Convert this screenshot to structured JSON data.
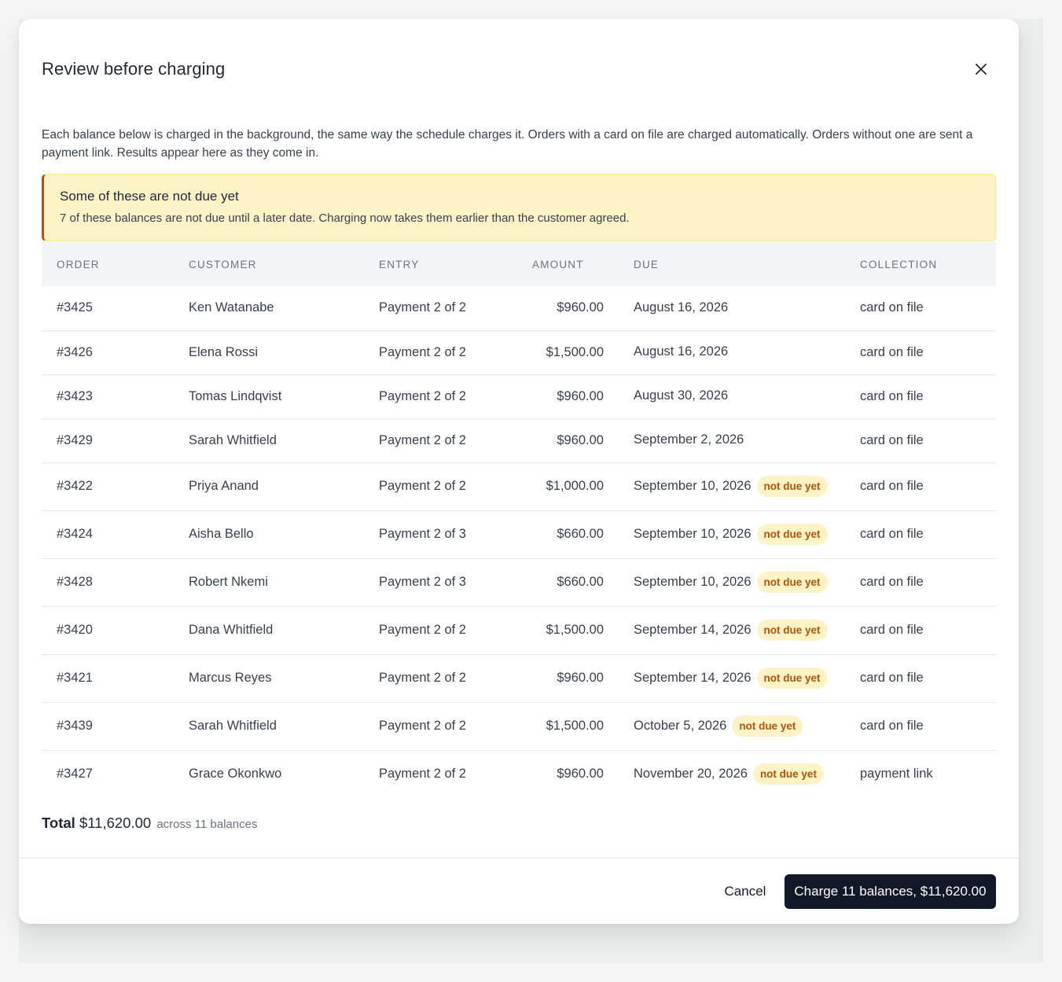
{
  "dialog": {
    "title": "Review before charging",
    "close_icon": "close-icon",
    "description": "Each balance below is charged in the background, the same way the schedule charges it. Orders with a card on file are charged automatically. Orders without one are sent a payment link. Results appear here as they come in."
  },
  "warning": {
    "title": "Some of these are not due yet",
    "text": "7 of these balances are not due until a later date. Charging now takes them earlier than the customer agreed.",
    "accent_color": "#b45309"
  },
  "table": {
    "headers": {
      "order": "ORDER",
      "customer": "CUSTOMER",
      "entry": "ENTRY",
      "amount": "AMOUNT",
      "due": "DUE",
      "collection": "COLLECTION"
    },
    "rows": [
      {
        "order": "#3425",
        "customer": "Ken Watanabe",
        "entry": "Payment 2 of 2",
        "amount": "$960.00",
        "due": "August 16, 2026",
        "badge": "",
        "collection": "card on file"
      },
      {
        "order": "#3426",
        "customer": "Elena Rossi",
        "entry": "Payment 2 of 2",
        "amount": "$1,500.00",
        "due": "August 16, 2026",
        "badge": "",
        "collection": "card on file"
      },
      {
        "order": "#3423",
        "customer": "Tomas Lindqvist",
        "entry": "Payment 2 of 2",
        "amount": "$960.00",
        "due": "August 30, 2026",
        "badge": "",
        "collection": "card on file"
      },
      {
        "order": "#3429",
        "customer": "Sarah Whitfield",
        "entry": "Payment 2 of 2",
        "amount": "$960.00",
        "due": "September 2, 2026",
        "badge": "",
        "collection": "card on file"
      },
      {
        "order": "#3422",
        "customer": "Priya Anand",
        "entry": "Payment 2 of 2",
        "amount": "$1,000.00",
        "due": "September 10, 2026",
        "badge": "not due yet",
        "collection": "card on file"
      },
      {
        "order": "#3424",
        "customer": "Aisha Bello",
        "entry": "Payment 2 of 3",
        "amount": "$660.00",
        "due": "September 10, 2026",
        "badge": "not due yet",
        "collection": "card on file"
      },
      {
        "order": "#3428",
        "customer": "Robert Nkemi",
        "entry": "Payment 2 of 3",
        "amount": "$660.00",
        "due": "September 10, 2026",
        "badge": "not due yet",
        "collection": "card on file"
      },
      {
        "order": "#3420",
        "customer": "Dana Whitfield",
        "entry": "Payment 2 of 2",
        "amount": "$1,500.00",
        "due": "September 14, 2026",
        "badge": "not due yet",
        "collection": "card on file"
      },
      {
        "order": "#3421",
        "customer": "Marcus Reyes",
        "entry": "Payment 2 of 2",
        "amount": "$960.00",
        "due": "September 14, 2026",
        "badge": "not due yet",
        "collection": "card on file"
      },
      {
        "order": "#3439",
        "customer": "Sarah Whitfield",
        "entry": "Payment 2 of 2",
        "amount": "$1,500.00",
        "due": "October 5, 2026",
        "badge": "not due yet",
        "collection": "card on file"
      },
      {
        "order": "#3427",
        "customer": "Grace Okonkwo",
        "entry": "Payment 2 of 2",
        "amount": "$960.00",
        "due": "November 20, 2026",
        "badge": "not due yet",
        "collection": "payment link"
      }
    ]
  },
  "total": {
    "label": "Total",
    "amount": "$11,620.00",
    "suffix": "across 11 balances"
  },
  "footer": {
    "cancel_label": "Cancel",
    "charge_label": "Charge 11 balances, $11,620.00"
  }
}
